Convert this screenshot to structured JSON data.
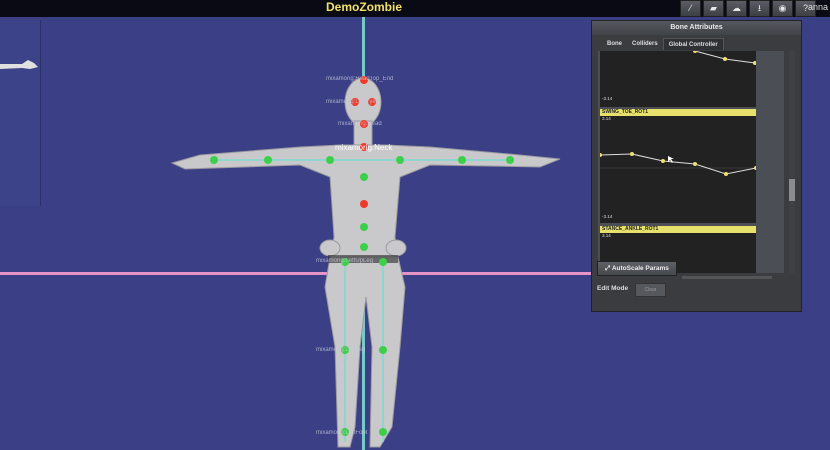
{
  "app": {
    "title": "DemoZombie",
    "user": "anna"
  },
  "toolbar": {
    "buttons": [
      {
        "name": "wand-icon",
        "glyph": "⁄"
      },
      {
        "name": "folder-icon",
        "glyph": "▰"
      },
      {
        "name": "cloud-upload-icon",
        "glyph": "☁"
      },
      {
        "name": "download-icon",
        "glyph": "⭳"
      },
      {
        "name": "globe-icon",
        "glyph": "◉"
      },
      {
        "name": "help-icon",
        "glyph": "?"
      }
    ]
  },
  "viewport": {
    "neck_label": "mixamorig:Neck",
    "joint_labels": {
      "head_top": "mixamorig:HeadTop_End",
      "left_eye": "mixamorig:LeftEye",
      "head": "mixamorig:Head",
      "upleg": "mixamorig:LeftUpLeg",
      "leg": "mixamorig:LeftLeg",
      "foot": "mixamorig:LeftFoot"
    }
  },
  "bone_panel": {
    "title": "Bone Attributes",
    "tabs": [
      "Bone",
      "Colliders",
      "Global Controller"
    ],
    "active_tab": "Global Controller",
    "graphs": [
      {
        "name": "",
        "min_label": "-3.14",
        "values": [
          0.2,
          0.5,
          0.1,
          0.0
        ]
      },
      {
        "name": "SWING_TOE_ROT1",
        "max_label": "3.14",
        "min_label": "-3.14",
        "values": [
          0.35,
          0.4,
          0.2,
          0.05,
          0.25,
          0.0,
          0.1
        ]
      },
      {
        "name": "STANCE_ANKLE_ROT1",
        "max_label": "3.14"
      }
    ],
    "autoscale_label": "AutoScale Params",
    "edit_mode_label": "Edit Mode",
    "edit_mode_button": "Clear"
  }
}
